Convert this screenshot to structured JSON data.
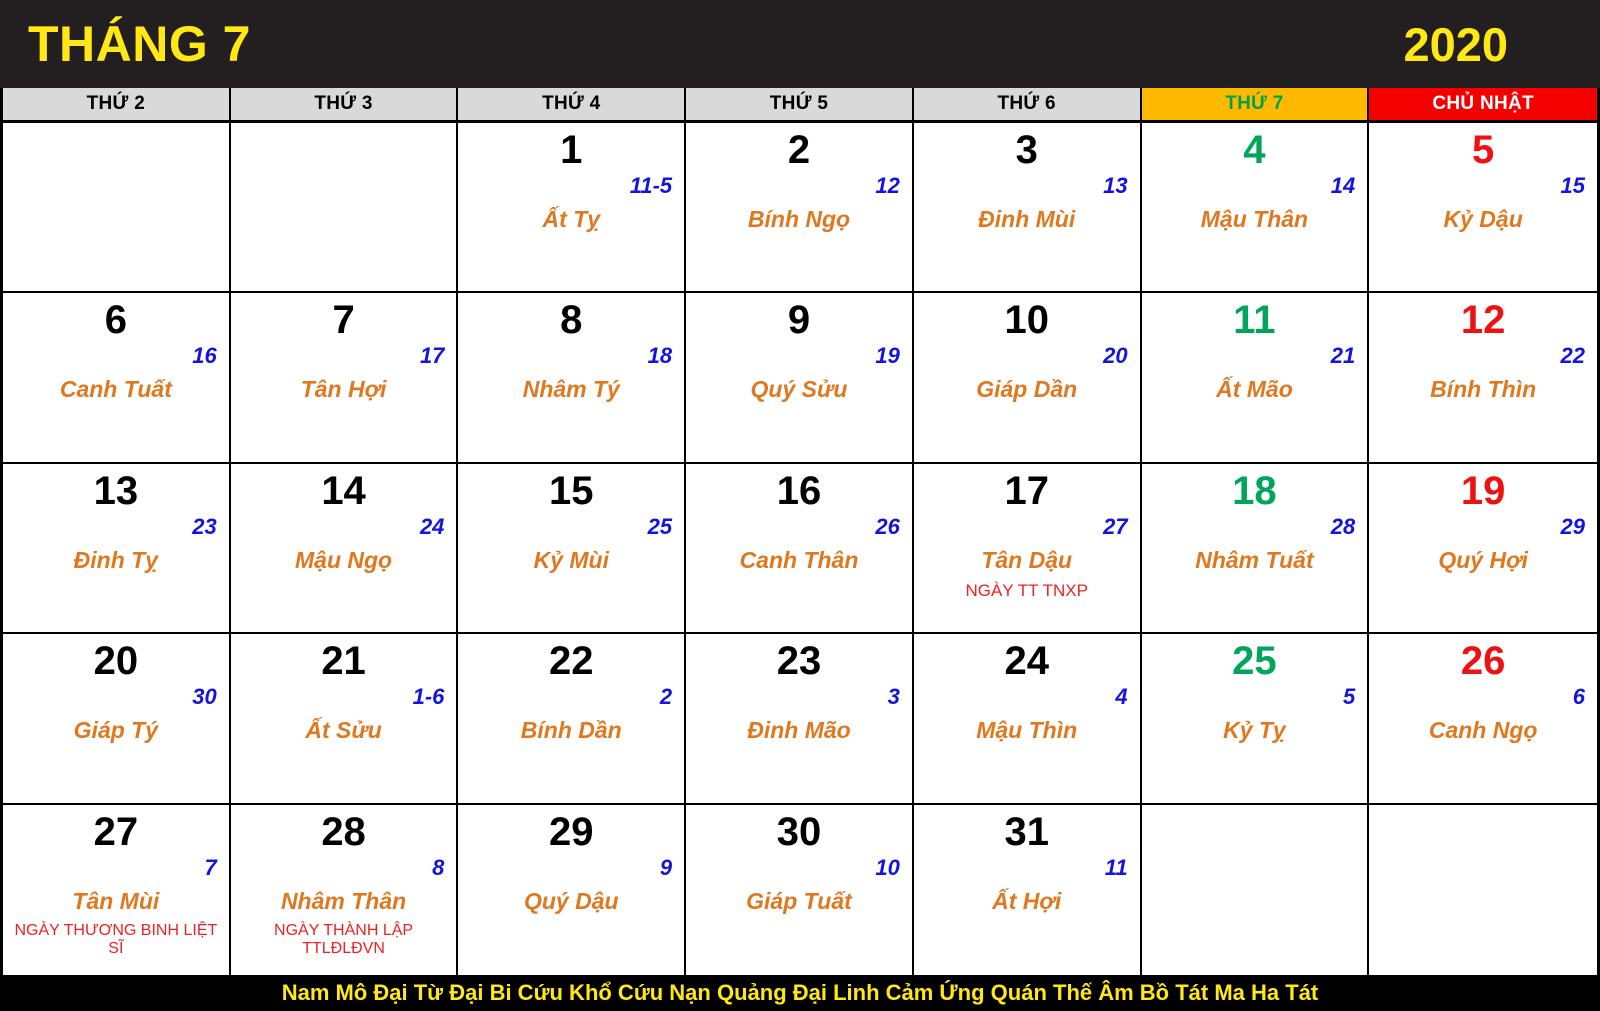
{
  "header": {
    "month_label": "THÁNG 7",
    "year_label": "2020",
    "bg_color": "#231f20",
    "text_color": "#ffe814"
  },
  "weekdays": [
    {
      "label": "THỨ 2",
      "kind": "weekday"
    },
    {
      "label": "THỨ 3",
      "kind": "weekday"
    },
    {
      "label": "THỨ 4",
      "kind": "weekday"
    },
    {
      "label": "THỨ 5",
      "kind": "weekday"
    },
    {
      "label": "THỨ 6",
      "kind": "weekday"
    },
    {
      "label": "THỨ 7",
      "kind": "saturday"
    },
    {
      "label": "CHỦ NHẬT",
      "kind": "sunday"
    }
  ],
  "colors": {
    "saturday_header_bg": "#ffb900",
    "saturday_header_text": "#00a34a",
    "sunday_header_bg": "#f40000",
    "sunday_header_text": "#ffffff",
    "weekday_header_bg": "#d9d9d9",
    "solar_default": "#000000",
    "solar_saturday": "#00a559",
    "solar_sunday": "#ee1111",
    "lunar": "#1414e0",
    "canchi": "#e07820",
    "note": "#ee2222",
    "footer_bg": "#000000",
    "footer_text": "#ffe814"
  },
  "weeks": [
    [
      {
        "solar": "",
        "lunar": "",
        "canchi": "",
        "note": "",
        "empty": true
      },
      {
        "solar": "",
        "lunar": "",
        "canchi": "",
        "note": "",
        "empty": true
      },
      {
        "solar": "1",
        "lunar": "11-5",
        "canchi": "Ất Tỵ",
        "note": ""
      },
      {
        "solar": "2",
        "lunar": "12",
        "canchi": "Bính Ngọ",
        "note": ""
      },
      {
        "solar": "3",
        "lunar": "13",
        "canchi": "Đinh Mùi",
        "note": ""
      },
      {
        "solar": "4",
        "lunar": "14",
        "canchi": "Mậu Thân",
        "note": ""
      },
      {
        "solar": "5",
        "lunar": "15",
        "canchi": "Kỷ Dậu",
        "note": ""
      }
    ],
    [
      {
        "solar": "6",
        "lunar": "16",
        "canchi": "Canh Tuất",
        "note": ""
      },
      {
        "solar": "7",
        "lunar": "17",
        "canchi": "Tân Hợi",
        "note": ""
      },
      {
        "solar": "8",
        "lunar": "18",
        "canchi": "Nhâm Tý",
        "note": ""
      },
      {
        "solar": "9",
        "lunar": "19",
        "canchi": "Quý Sửu",
        "note": ""
      },
      {
        "solar": "10",
        "lunar": "20",
        "canchi": "Giáp Dần",
        "note": ""
      },
      {
        "solar": "11",
        "lunar": "21",
        "canchi": "Ất Mão",
        "note": ""
      },
      {
        "solar": "12",
        "lunar": "22",
        "canchi": "Bính Thìn",
        "note": ""
      }
    ],
    [
      {
        "solar": "13",
        "lunar": "23",
        "canchi": "Đinh Tỵ",
        "note": ""
      },
      {
        "solar": "14",
        "lunar": "24",
        "canchi": "Mậu Ngọ",
        "note": ""
      },
      {
        "solar": "15",
        "lunar": "25",
        "canchi": "Kỷ Mùi",
        "note": ""
      },
      {
        "solar": "16",
        "lunar": "26",
        "canchi": "Canh Thân",
        "note": ""
      },
      {
        "solar": "17",
        "lunar": "27",
        "canchi": "Tân Dậu",
        "note": "NGÀY TT TNXP"
      },
      {
        "solar": "18",
        "lunar": "28",
        "canchi": "Nhâm Tuất",
        "note": ""
      },
      {
        "solar": "19",
        "lunar": "29",
        "canchi": "Quý Hợi",
        "note": ""
      }
    ],
    [
      {
        "solar": "20",
        "lunar": "30",
        "canchi": "Giáp Tý",
        "note": ""
      },
      {
        "solar": "21",
        "lunar": "1-6",
        "canchi": "Ất Sửu",
        "note": ""
      },
      {
        "solar": "22",
        "lunar": "2",
        "canchi": "Bính Dần",
        "note": ""
      },
      {
        "solar": "23",
        "lunar": "3",
        "canchi": "Đinh Mão",
        "note": ""
      },
      {
        "solar": "24",
        "lunar": "4",
        "canchi": "Mậu Thìn",
        "note": ""
      },
      {
        "solar": "25",
        "lunar": "5",
        "canchi": "Kỷ Tỵ",
        "note": ""
      },
      {
        "solar": "26",
        "lunar": "6",
        "canchi": "Canh Ngọ",
        "note": ""
      }
    ],
    [
      {
        "solar": "27",
        "lunar": "7",
        "canchi": "Tân Mùi",
        "note": "NGÀY THƯƠNG BINH LIỆT SĨ"
      },
      {
        "solar": "28",
        "lunar": "8",
        "canchi": "Nhâm Thân",
        "note": "NGÀY THÀNH LẬP TTLĐLĐVN"
      },
      {
        "solar": "29",
        "lunar": "9",
        "canchi": "Quý Dậu",
        "note": ""
      },
      {
        "solar": "30",
        "lunar": "10",
        "canchi": "Giáp Tuất",
        "note": ""
      },
      {
        "solar": "31",
        "lunar": "11",
        "canchi": "Ất Hợi",
        "note": ""
      },
      {
        "solar": "",
        "lunar": "",
        "canchi": "",
        "note": "",
        "empty": true
      },
      {
        "solar": "",
        "lunar": "",
        "canchi": "",
        "note": "",
        "empty": true
      }
    ]
  ],
  "footer": {
    "text": "Nam Mô Đại Từ Đại Bi Cứu Khổ Cứu Nạn Quảng Đại Linh Cảm Ứng Quán Thế Âm Bồ Tát Ma Ha Tát"
  }
}
